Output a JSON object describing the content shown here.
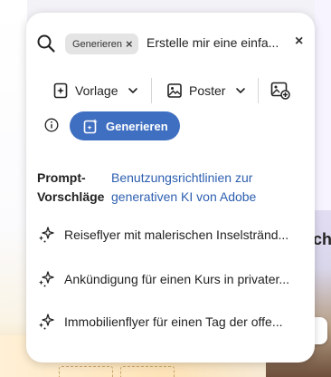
{
  "background": {
    "card_text": "ch"
  },
  "search": {
    "tag_label": "Generieren",
    "tag_remove": "×",
    "query": "Erstelle mir eine einfa...",
    "clear": "×"
  },
  "options": {
    "template_label": "Vorlage",
    "format_label": "Poster"
  },
  "generate": {
    "button_label": "Generieren"
  },
  "suggestions": {
    "heading": "Prompt-Vorschläge",
    "guidelines_link": "Benutzungsrichtlinien zur generativen KI von Adobe",
    "items": [
      "Reiseflyer mit malerischen Inselstränd...",
      "Ankündigung für einen Kurs in privater...",
      "Immobilienflyer für einen Tag der offe..."
    ]
  },
  "colors": {
    "accent": "#3f6fc1",
    "link": "#2d5fb0",
    "tag_bg": "#e4e4e4"
  }
}
